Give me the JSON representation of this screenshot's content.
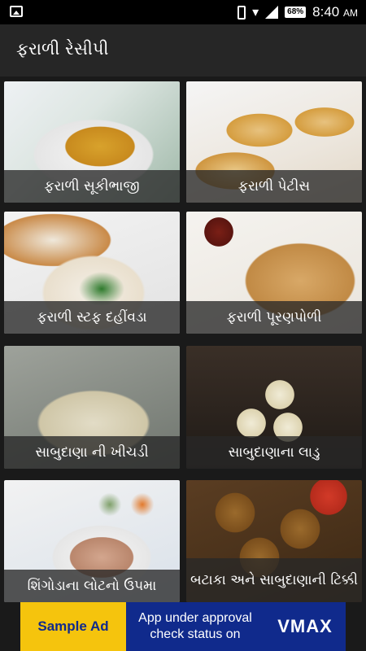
{
  "status_bar": {
    "battery": "68%",
    "time": "8:40",
    "ampm": "AM",
    "icons": [
      "image-icon",
      "phone-icon",
      "wifi-icon",
      "signal-icon",
      "battery-icon"
    ]
  },
  "app_bar": {
    "title": "ફરાળી રેસીપી"
  },
  "recipes": [
    {
      "label": "ફરાળી સૂકીભાજી"
    },
    {
      "label": "ફરાળી પેટીસ"
    },
    {
      "label": "ફરાળી સ્ટફ દહીંવડા"
    },
    {
      "label": "ફરાળી પૂરણપોળી"
    },
    {
      "label": "સાબુદાણા ની ખીચડી"
    },
    {
      "label": "સાબુદાણાના લાડુ"
    },
    {
      "label": "શિંગોડાના લોટનો ઉપમા"
    },
    {
      "label": "બટાકા અને સાબુદાણાની ટિક્કી"
    }
  ],
  "ad": {
    "sample_label": "Sample Ad",
    "message": "App under approval check status on",
    "brand": "VMAX",
    "colors": {
      "background": "#102a8c",
      "badge": "#f5c40d"
    }
  }
}
